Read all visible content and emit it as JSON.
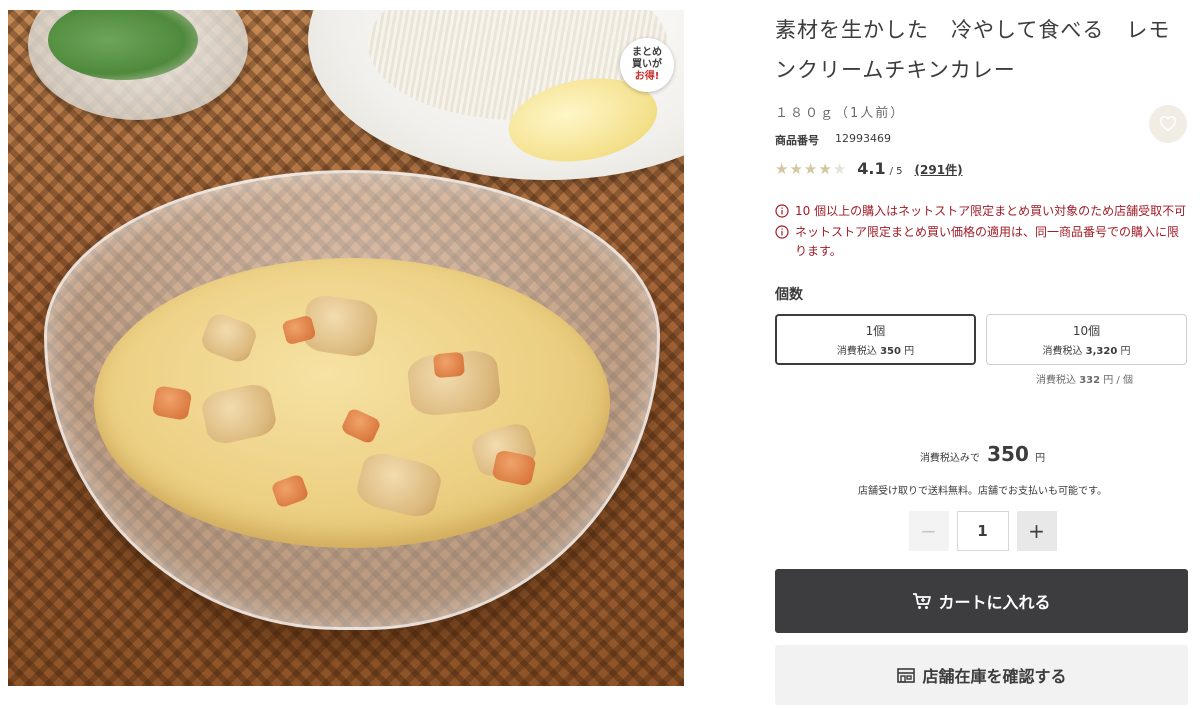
{
  "product": {
    "title": "素材を生かした　冷やして食べる　レモンクリームチキンカレー",
    "weight": "１８０ｇ（1人前）",
    "code_label": "商品番号",
    "code": "12993469",
    "image_alt": "レモンクリームチキンカレー",
    "badge": {
      "line1": "まとめ",
      "line2": "買いが",
      "line3": "お得!"
    },
    "favorite_icon": "heart-icon"
  },
  "rating": {
    "score": "4.1",
    "out_of": "/ 5",
    "count": "(291件)",
    "stars_filled": 4,
    "stars_total": 5,
    "star_color": "#d4c6a0"
  },
  "notices": [
    "10 個以上の購入はネットストア限定まとめ買い対象のため店舗受取不可",
    "ネットストア限定まとめ買い価格の適用は、同一商品番号での購入に限ります。"
  ],
  "quantity": {
    "label": "個数",
    "options": [
      {
        "name": "1個",
        "price_prefix": "消費税込",
        "price": "350",
        "unit": "円",
        "selected": true
      },
      {
        "name": "10個",
        "price_prefix": "消費税込",
        "price": "3,320",
        "unit": "円",
        "selected": false
      }
    ],
    "per_unit_prefix": "消費税込",
    "per_unit_price": "332",
    "per_unit_suffix": "円 / 個"
  },
  "price": {
    "prefix": "消費税込みで",
    "value": "350",
    "unit": "円"
  },
  "pickup_note": "店舗受け取りで送料無料。店舗でお支払いも可能です。",
  "stepper": {
    "minus": "−",
    "value": "1",
    "plus": "+"
  },
  "buttons": {
    "cart": "カートに入れる",
    "cart_icon": "cart-icon",
    "store": "店舗在庫を確認する",
    "store_icon": "store-icon"
  },
  "colors": {
    "notice": "#a11c28",
    "cart_button": "#3d3d40",
    "badge_accent": "#c8312c"
  }
}
